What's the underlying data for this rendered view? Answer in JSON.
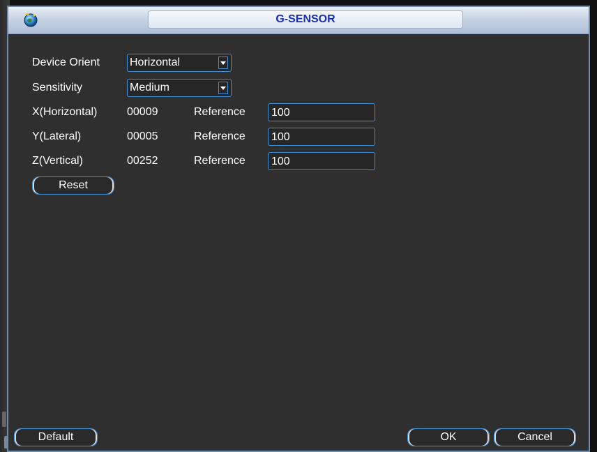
{
  "window": {
    "title": "G-SENSOR"
  },
  "icons": {
    "title_icon": "globe-icon",
    "dropdown_arrow": "chevron-down-icon"
  },
  "colors": {
    "title_text": "#1a2fb8",
    "field_border": "#3d8fd8",
    "window_bg": "#2f2f2f"
  },
  "form": {
    "device_orient": {
      "label": "Device Orient",
      "value": "Horizontal"
    },
    "sensitivity": {
      "label": "Sensitivity",
      "value": "Medium"
    },
    "axes": [
      {
        "label": "X(Horizontal)",
        "reading": "00009",
        "reference_label": "Reference",
        "reference_value": "100"
      },
      {
        "label": "Y(Lateral)",
        "reading": "00005",
        "reference_label": "Reference",
        "reference_value": "100"
      },
      {
        "label": "Z(Vertical)",
        "reading": "00252",
        "reference_label": "Reference",
        "reference_value": "100"
      }
    ],
    "reset_label": "Reset"
  },
  "footer": {
    "default_label": "Default",
    "ok_label": "OK",
    "cancel_label": "Cancel"
  }
}
